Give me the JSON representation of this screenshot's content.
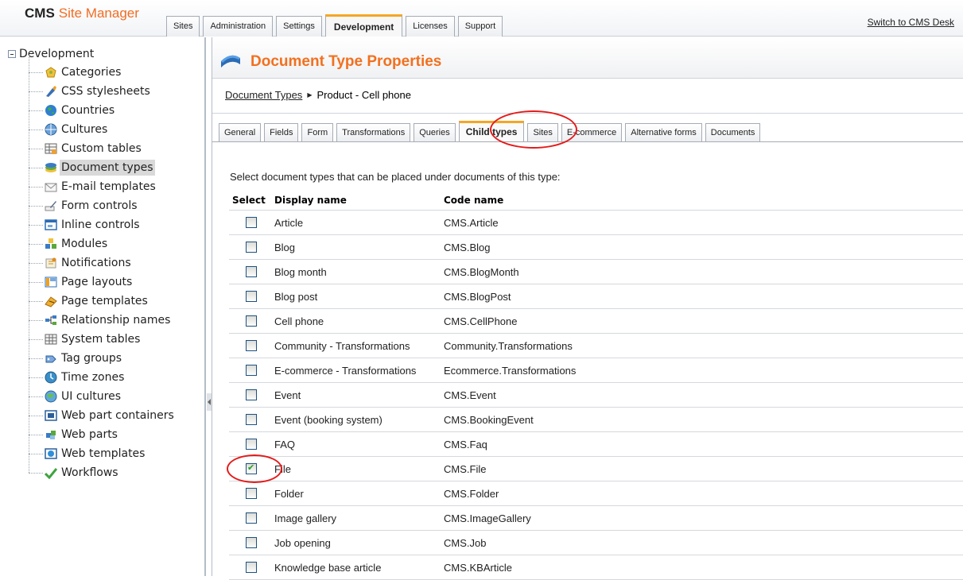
{
  "header": {
    "logo_bold": "CMS",
    "logo_rest": "Site Manager",
    "tabs": [
      {
        "label": "Sites"
      },
      {
        "label": "Administration"
      },
      {
        "label": "Settings"
      },
      {
        "label": "Development"
      },
      {
        "label": "Licenses"
      },
      {
        "label": "Support"
      }
    ],
    "active_tab": "Development",
    "switch_link": "Switch to CMS Desk"
  },
  "tree": {
    "root": "Development",
    "items": [
      {
        "label": "Categories",
        "icon": "categories-icon"
      },
      {
        "label": "CSS stylesheets",
        "icon": "css-stylesheets-icon"
      },
      {
        "label": "Countries",
        "icon": "countries-icon"
      },
      {
        "label": "Cultures",
        "icon": "cultures-icon"
      },
      {
        "label": "Custom tables",
        "icon": "custom-tables-icon"
      },
      {
        "label": "Document types",
        "icon": "document-types-icon"
      },
      {
        "label": "E-mail templates",
        "icon": "email-templates-icon"
      },
      {
        "label": "Form controls",
        "icon": "form-controls-icon"
      },
      {
        "label": "Inline controls",
        "icon": "inline-controls-icon"
      },
      {
        "label": "Modules",
        "icon": "modules-icon"
      },
      {
        "label": "Notifications",
        "icon": "notifications-icon"
      },
      {
        "label": "Page layouts",
        "icon": "page-layouts-icon"
      },
      {
        "label": "Page templates",
        "icon": "page-templates-icon"
      },
      {
        "label": "Relationship names",
        "icon": "relationship-names-icon"
      },
      {
        "label": "System tables",
        "icon": "system-tables-icon"
      },
      {
        "label": "Tag groups",
        "icon": "tag-groups-icon"
      },
      {
        "label": "Time zones",
        "icon": "time-zones-icon"
      },
      {
        "label": "UI cultures",
        "icon": "ui-cultures-icon"
      },
      {
        "label": "Web part containers",
        "icon": "web-part-containers-icon"
      },
      {
        "label": "Web parts",
        "icon": "web-parts-icon"
      },
      {
        "label": "Web templates",
        "icon": "web-templates-icon"
      },
      {
        "label": "Workflows",
        "icon": "workflows-icon"
      }
    ],
    "selected": "Document types"
  },
  "main": {
    "title": "Document Type Properties",
    "breadcrumb": {
      "link": "Document Types",
      "current": "Product - Cell phone"
    },
    "tabs": [
      {
        "label": "General"
      },
      {
        "label": "Fields"
      },
      {
        "label": "Form"
      },
      {
        "label": "Transformations"
      },
      {
        "label": "Queries"
      },
      {
        "label": "Child types"
      },
      {
        "label": "Sites"
      },
      {
        "label": "E-commerce"
      },
      {
        "label": "Alternative forms"
      },
      {
        "label": "Documents"
      }
    ],
    "active_tab": "Child types",
    "instruction": "Select document types that can be placed under documents of this type:",
    "columns": {
      "select": "Select",
      "display": "Display name",
      "code": "Code name"
    },
    "rows": [
      {
        "display": "Article",
        "code": "CMS.Article",
        "checked": false
      },
      {
        "display": "Blog",
        "code": "CMS.Blog",
        "checked": false
      },
      {
        "display": "Blog month",
        "code": "CMS.BlogMonth",
        "checked": false
      },
      {
        "display": "Blog post",
        "code": "CMS.BlogPost",
        "checked": false
      },
      {
        "display": "Cell phone",
        "code": "CMS.CellPhone",
        "checked": false
      },
      {
        "display": "Community - Transformations",
        "code": "Community.Transformations",
        "checked": false
      },
      {
        "display": "E-commerce - Transformations",
        "code": "Ecommerce.Transformations",
        "checked": false
      },
      {
        "display": "Event",
        "code": "CMS.Event",
        "checked": false
      },
      {
        "display": "Event (booking system)",
        "code": "CMS.BookingEvent",
        "checked": false
      },
      {
        "display": "FAQ",
        "code": "CMS.Faq",
        "checked": false
      },
      {
        "display": "File",
        "code": "CMS.File",
        "checked": true
      },
      {
        "display": "Folder",
        "code": "CMS.Folder",
        "checked": false
      },
      {
        "display": "Image gallery",
        "code": "CMS.ImageGallery",
        "checked": false
      },
      {
        "display": "Job opening",
        "code": "CMS.Job",
        "checked": false
      },
      {
        "display": "Knowledge base article",
        "code": "CMS.KBArticle",
        "checked": false
      }
    ]
  },
  "colors": {
    "accent_orange": "#f2701e",
    "annotation_red": "#e41b1b",
    "tab_highlight": "#f5a623"
  }
}
